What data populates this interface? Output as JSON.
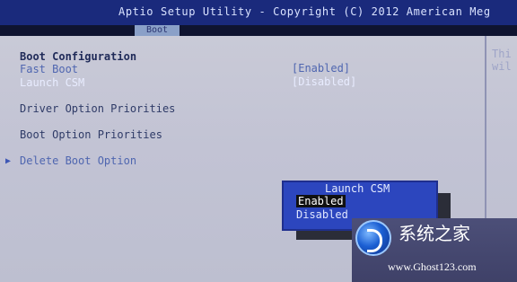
{
  "header": {
    "title": "Aptio Setup Utility - Copyright (C) 2012 American Meg",
    "active_tab": "Boot"
  },
  "settings": {
    "section_title": "Boot Configuration",
    "fast_boot": {
      "label": "Fast Boot",
      "value": "[Enabled]"
    },
    "launch_csm": {
      "label": "Launch CSM",
      "value": "[Disabled]"
    },
    "driver_option_priorities": "Driver Option Priorities",
    "boot_option_priorities": "Boot Option Priorities",
    "delete_boot_option": "Delete Boot Option"
  },
  "help_panel": {
    "line1": "Thi",
    "line2": "wil"
  },
  "popup": {
    "title": "Launch CSM",
    "options": [
      "Enabled",
      "Disabled"
    ],
    "selected": "Enabled"
  },
  "watermark": {
    "chinese": "系统之家",
    "url": "www.Ghost123.com"
  },
  "colors": {
    "header_bg": "#1a2a7c",
    "main_bg": "#c9cad7",
    "popup_bg": "#2c46be",
    "accent_blue": "#4f66b0"
  }
}
